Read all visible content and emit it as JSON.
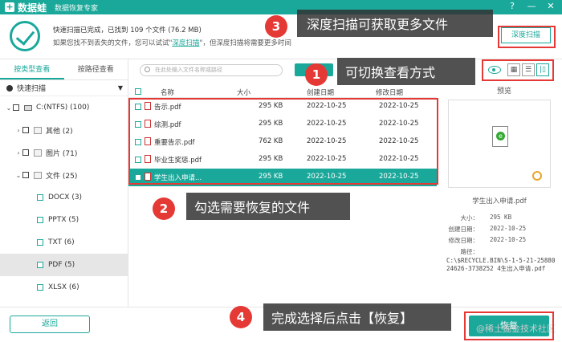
{
  "titlebar": {
    "app_name": "数据蛙",
    "sub_name": "数据恢复专家",
    "help": "?",
    "minimize": "—",
    "close": "✕"
  },
  "header": {
    "status_line1": "快速扫描已完成，已找到 109 个文件 (76.2 MB)",
    "status_line2_prefix": "如果您找不到丢失的文件，您可以试试\"",
    "status_line2_link": "深度扫描",
    "status_line2_suffix": "\"，但深度扫描将需要更多时间",
    "deep_scan_button": "深度扫描"
  },
  "sidebar": {
    "tabs": [
      "按类型查看",
      "按路径查看"
    ],
    "quick_scan": "快速扫描",
    "tree": [
      {
        "label": "C:(NTFS) (100)"
      },
      {
        "label": "其他 (2)"
      },
      {
        "label": "图片 (71)"
      },
      {
        "label": "文件 (25)"
      },
      {
        "label": "DOCX (3)"
      },
      {
        "label": "PPTX (5)"
      },
      {
        "label": "TXT (6)"
      },
      {
        "label": "PDF (5)"
      },
      {
        "label": "XLSX (6)"
      }
    ]
  },
  "main": {
    "search_placeholder": "在此处输入文件名称或路径",
    "columns": {
      "name": "名称",
      "size": "大小",
      "created": "创建日期",
      "modified": "修改日期"
    },
    "files": [
      {
        "name": "告示.pdf",
        "size": "295 KB",
        "created": "2022-10-25",
        "modified": "2022-10-25"
      },
      {
        "name": "综测.pdf",
        "size": "295 KB",
        "created": "2022-10-25",
        "modified": "2022-10-25"
      },
      {
        "name": "重要告示.pdf",
        "size": "762 KB",
        "created": "2022-10-25",
        "modified": "2022-10-25"
      },
      {
        "name": "毕业生奖惩.pdf",
        "size": "295 KB",
        "created": "2022-10-25",
        "modified": "2022-10-25"
      },
      {
        "name": "学生出入申请...",
        "size": "295 KB",
        "created": "2022-10-25",
        "modified": "2022-10-25"
      }
    ]
  },
  "viewbar": {
    "grid": "▦",
    "list": "☰",
    "detail": "|▯"
  },
  "preview": {
    "label": "预览",
    "file_name": "学生出入申请.pdf",
    "size_label": "大小：",
    "size_value": "295 KB",
    "created_label": "创建日期：",
    "created_value": "2022-10-25",
    "modified_label": "修改日期：",
    "modified_value": "2022-10-25",
    "path_label": "路径：",
    "path_value": "C:\\$RECYCLE.BIN\\S-1-5-21-2588024626-3738252 4生出入申请.pdf"
  },
  "footer": {
    "back_button": "返回",
    "recover_button": "恢复",
    "watermark": "@稀土掘金技术社区"
  },
  "callouts": [
    {
      "num": "1",
      "text": "可切换查看方式"
    },
    {
      "num": "2",
      "text": "勾选需要恢复的文件"
    },
    {
      "num": "3",
      "text": "深度扫描可获取更多文件"
    },
    {
      "num": "4",
      "text": "完成选择后点击【恢复】"
    }
  ],
  "colors": {
    "accent": "#1aa89a",
    "highlight": "#e53935"
  }
}
